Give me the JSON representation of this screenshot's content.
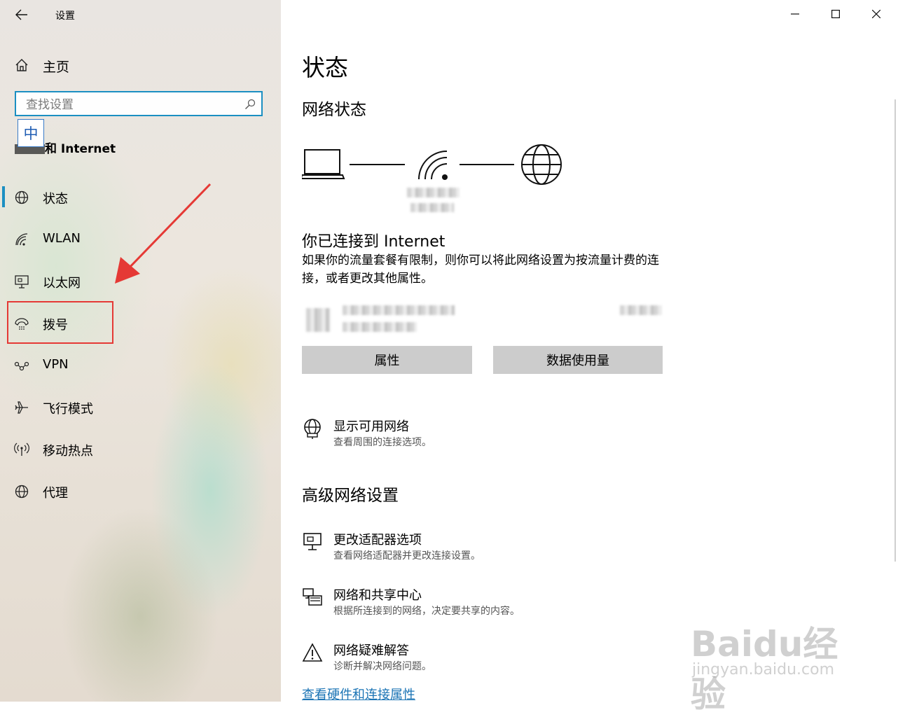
{
  "window": {
    "title": "设置"
  },
  "sidebar": {
    "home_label": "主页",
    "search_placeholder": "查找设置",
    "ime_indicator": "中",
    "section_heading": "和 Internet",
    "active_indicator_color": "#1b8fc2",
    "items": [
      {
        "id": "status",
        "label": "状态",
        "icon": "globe-icon",
        "active": true
      },
      {
        "id": "wlan",
        "label": "WLAN",
        "icon": "wifi-icon"
      },
      {
        "id": "ethernet",
        "label": "以太网",
        "icon": "ethernet-icon"
      },
      {
        "id": "dialup",
        "label": "拨号",
        "icon": "dialup-icon"
      },
      {
        "id": "vpn",
        "label": "VPN",
        "icon": "vpn-icon"
      },
      {
        "id": "airplane",
        "label": "飞行模式",
        "icon": "airplane-icon"
      },
      {
        "id": "hotspot",
        "label": "移动热点",
        "icon": "hotspot-icon"
      },
      {
        "id": "proxy",
        "label": "代理",
        "icon": "globe-icon"
      }
    ]
  },
  "main": {
    "page_title": "状态",
    "network_status_heading": "网络状态",
    "connected_title": "你已连接到 Internet",
    "connected_desc": "如果你的流量套餐有限制，则你可以将此网络设置为按流量计费的连接，或者更改其他属性。",
    "buttons": {
      "properties": "属性",
      "data_usage": "数据使用量"
    },
    "show_networks": {
      "title": "显示可用网络",
      "desc": "查看周围的连接选项。"
    },
    "advanced_heading": "高级网络设置",
    "advanced_items": [
      {
        "title": "更改适配器选项",
        "desc": "查看网络适配器并更改连接设置。",
        "icon": "adapter-icon"
      },
      {
        "title": "网络和共享中心",
        "desc": "根据所连接到的网络，决定要共享的内容。",
        "icon": "sharing-center-icon"
      },
      {
        "title": "网络疑难解答",
        "desc": "诊断并解决网络问题。",
        "icon": "warning-icon"
      }
    ],
    "bottom_link": "查看硬件和连接属性"
  },
  "colors": {
    "accent": "#1b8fc2",
    "link": "#1b74b5",
    "annotation": "#e53935",
    "button_bg": "#cccccc"
  },
  "watermark": {
    "brand": "Baidu经验",
    "url": "jingyan.baidu.com"
  }
}
